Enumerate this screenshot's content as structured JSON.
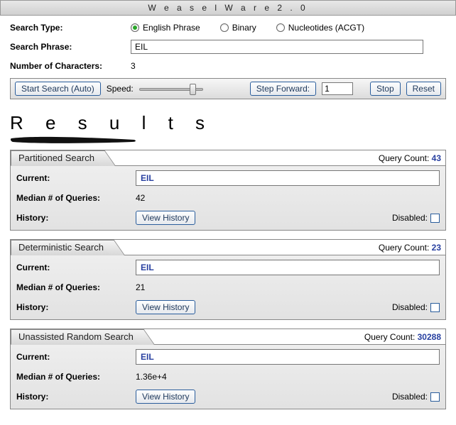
{
  "app": {
    "title": "W e a s e l   W a r e   2 . 0"
  },
  "form": {
    "search_type_label": "Search Type:",
    "search_phrase_label": "Search Phrase:",
    "num_chars_label": "Number of Characters:",
    "radio_options": [
      {
        "label": "English Phrase",
        "selected": true
      },
      {
        "label": "Binary",
        "selected": false
      },
      {
        "label": "Nucleotides (ACGT)",
        "selected": false
      }
    ],
    "search_phrase_value": "EIL",
    "num_chars_value": "3"
  },
  "toolbar": {
    "start_label": "Start Search (Auto)",
    "speed_label": "Speed:",
    "slider_position_pct": 85,
    "step_forward_label": "Step Forward:",
    "step_value": "1",
    "stop_label": "Stop",
    "reset_label": "Reset"
  },
  "results": {
    "title": "R e s u l t s"
  },
  "labels": {
    "query_count": "Query Count:",
    "current": "Current:",
    "median": "Median # of Queries:",
    "history": "History:",
    "view_history": "View History",
    "disabled": "Disabled:"
  },
  "panels": [
    {
      "title": "Partitioned Search",
      "query_count": "43",
      "current": "EIL",
      "median": "42"
    },
    {
      "title": "Deterministic Search",
      "query_count": "23",
      "current": "EIL",
      "median": "21"
    },
    {
      "title": "Unassisted Random Search",
      "query_count": "30288",
      "current": "EIL",
      "median": "1.36e+4"
    }
  ]
}
